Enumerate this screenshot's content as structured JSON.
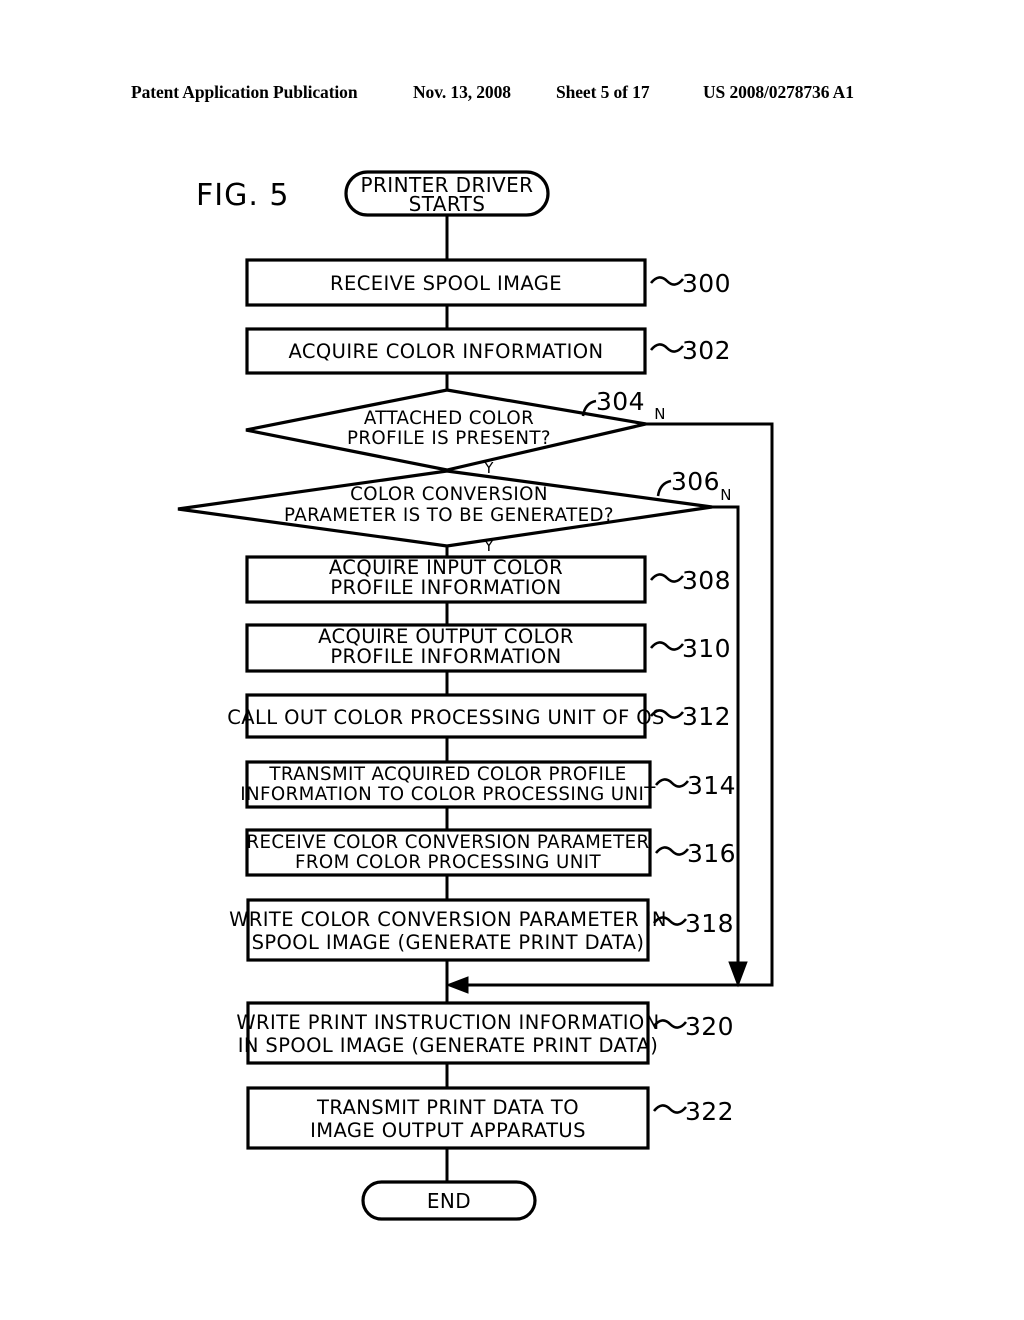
{
  "header": {
    "publication": "Patent Application Publication",
    "date": "Nov. 13, 2008",
    "sheet": "Sheet 5 of 17",
    "patent_number": "US 2008/0278736 A1"
  },
  "figure": {
    "label": "FIG. 5"
  },
  "flowchart": {
    "start": {
      "text_line1": "PRINTER DRIVER",
      "text_line2": "STARTS"
    },
    "end": {
      "text_line1": "END"
    },
    "steps": [
      {
        "ref": "300",
        "lines": [
          "RECEIVE SPOOL IMAGE"
        ]
      },
      {
        "ref": "302",
        "lines": [
          "ACQUIRE COLOR INFORMATION"
        ]
      },
      {
        "ref": "304",
        "lines": [
          "ATTACHED COLOR",
          "PROFILE IS PRESENT?"
        ],
        "shape": "decision",
        "yes_label": "Y",
        "no_label": "N"
      },
      {
        "ref": "306",
        "lines": [
          "COLOR CONVERSION",
          "PARAMETER IS TO BE GENERATED?"
        ],
        "shape": "decision",
        "yes_label": "Y",
        "no_label": "N"
      },
      {
        "ref": "308",
        "lines": [
          "ACQUIRE INPUT COLOR",
          "PROFILE INFORMATION"
        ]
      },
      {
        "ref": "310",
        "lines": [
          "ACQUIRE OUTPUT COLOR",
          "PROFILE INFORMATION"
        ]
      },
      {
        "ref": "312",
        "lines": [
          "CALL OUT COLOR PROCESSING UNIT OF OS"
        ]
      },
      {
        "ref": "314",
        "lines": [
          "TRANSMIT ACQUIRED COLOR PROFILE",
          "INFORMATION TO COLOR PROCESSING UNIT"
        ]
      },
      {
        "ref": "316",
        "lines": [
          "RECEIVE COLOR CONVERSION PARAMETER",
          "FROM COLOR PROCESSING UNIT"
        ]
      },
      {
        "ref": "318",
        "lines": [
          "WRITE COLOR CONVERSION PARAMETER IN",
          "SPOOL IMAGE (GENERATE PRINT DATA)"
        ]
      },
      {
        "ref": "320",
        "lines": [
          "WRITE PRINT INSTRUCTION INFORMATION",
          "IN SPOOL IMAGE (GENERATE PRINT DATA)"
        ]
      },
      {
        "ref": "322",
        "lines": [
          "TRANSMIT PRINT DATA TO",
          "IMAGE OUTPUT APPARATUS"
        ]
      }
    ]
  },
  "colors": {
    "ink": "#000000",
    "paper": "#ffffff"
  }
}
